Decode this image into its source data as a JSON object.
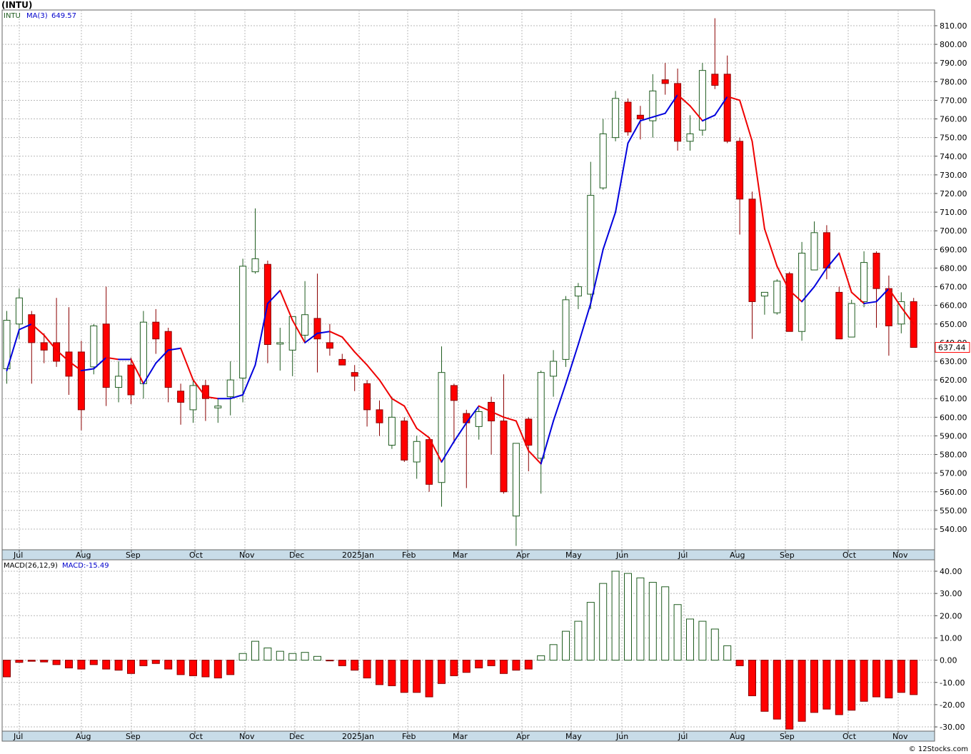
{
  "title": "(INTU)",
  "watermark": "© 12Stocks.com",
  "colors": {
    "up": "#1f5c1f",
    "down": "#ff0000",
    "ma_up": "#0000dd",
    "ma_down": "#ee0000",
    "axis_band": "#c8dce8",
    "grid": "#b8b8b8"
  },
  "price_panel": {
    "symbol": "INTU",
    "ma_label": "MA(3)",
    "ma_value": "649.57",
    "last_price": "637.44",
    "ylim": [
      530,
      815
    ],
    "yticks": [
      "810.00",
      "800.00",
      "790.00",
      "780.00",
      "770.00",
      "760.00",
      "750.00",
      "740.00",
      "730.00",
      "720.00",
      "710.00",
      "700.00",
      "690.00",
      "680.00",
      "670.00",
      "660.00",
      "650.00",
      "640.00",
      "630.00",
      "620.00",
      "610.00",
      "600.00",
      "590.00",
      "580.00",
      "570.00",
      "560.00",
      "550.00",
      "540.00"
    ]
  },
  "macd_panel": {
    "label": "MACD(26,12,9)",
    "value_label": "MACD:-15.49",
    "ylim": [
      -32,
      42
    ],
    "yticks": [
      "40.00",
      "30.00",
      "20.00",
      "10.00",
      "0.00",
      "-10.00",
      "-20.00",
      "-30.00"
    ]
  },
  "month_labels": [
    "Jul",
    "Aug",
    "Sep",
    "Oct",
    "Nov",
    "Dec",
    "2025Jan",
    "Feb",
    "Mar",
    "Apr",
    "May",
    "Jun",
    "Jul",
    "Aug",
    "Sep",
    "Oct",
    "Nov"
  ],
  "chart_data": [
    {
      "type": "candlestick",
      "series": [
        {
          "name": "INTU",
          "values": [
            {
              "o": 626,
              "h": 657,
              "l": 618,
              "c": 652
            },
            {
              "o": 650,
              "h": 669,
              "l": 642,
              "c": 664
            },
            {
              "o": 655,
              "h": 657,
              "l": 618,
              "c": 640
            },
            {
              "o": 640,
              "h": 645,
              "l": 629,
              "c": 636
            },
            {
              "o": 640,
              "h": 664,
              "l": 627,
              "c": 630
            },
            {
              "o": 635,
              "h": 659,
              "l": 612,
              "c": 622
            },
            {
              "o": 635,
              "h": 641,
              "l": 593,
              "c": 604
            },
            {
              "o": 627,
              "h": 650,
              "l": 623,
              "c": 649
            },
            {
              "o": 650,
              "h": 670,
              "l": 606,
              "c": 616
            },
            {
              "o": 616,
              "h": 630,
              "l": 608,
              "c": 622
            },
            {
              "o": 628,
              "h": 632,
              "l": 607,
              "c": 612
            },
            {
              "o": 618,
              "h": 657,
              "l": 610,
              "c": 651
            },
            {
              "o": 651,
              "h": 658,
              "l": 634,
              "c": 642
            },
            {
              "o": 646,
              "h": 648,
              "l": 608,
              "c": 616
            },
            {
              "o": 614,
              "h": 618,
              "l": 596,
              "c": 608
            },
            {
              "o": 604,
              "h": 620,
              "l": 597,
              "c": 617
            },
            {
              "o": 617,
              "h": 620,
              "l": 598,
              "c": 610
            },
            {
              "o": 605,
              "h": 610,
              "l": 597,
              "c": 606
            },
            {
              "o": 611,
              "h": 630,
              "l": 601,
              "c": 620
            },
            {
              "o": 621,
              "h": 685,
              "l": 608,
              "c": 681
            },
            {
              "o": 678,
              "h": 712,
              "l": 677,
              "c": 685
            },
            {
              "o": 682,
              "h": 684,
              "l": 629,
              "c": 639
            },
            {
              "o": 640,
              "h": 648,
              "l": 625,
              "c": 640
            },
            {
              "o": 636,
              "h": 650,
              "l": 622,
              "c": 654
            },
            {
              "o": 644,
              "h": 673,
              "l": 640,
              "c": 655
            },
            {
              "o": 653,
              "h": 677,
              "l": 624,
              "c": 642
            },
            {
              "o": 640,
              "h": 650,
              "l": 633,
              "c": 637
            },
            {
              "o": 631,
              "h": 634,
              "l": 628,
              "c": 628
            },
            {
              "o": 624,
              "h": 628,
              "l": 614,
              "c": 622
            },
            {
              "o": 618,
              "h": 620,
              "l": 595,
              "c": 604
            },
            {
              "o": 604,
              "h": 609,
              "l": 590,
              "c": 597
            },
            {
              "o": 585,
              "h": 611,
              "l": 583,
              "c": 600
            },
            {
              "o": 598,
              "h": 600,
              "l": 576,
              "c": 577
            },
            {
              "o": 576,
              "h": 590,
              "l": 567,
              "c": 587
            },
            {
              "o": 588,
              "h": 589,
              "l": 560,
              "c": 564
            },
            {
              "o": 565,
              "h": 638,
              "l": 552,
              "c": 624
            },
            {
              "o": 617,
              "h": 618,
              "l": 586,
              "c": 609
            },
            {
              "o": 602,
              "h": 604,
              "l": 562,
              "c": 597
            },
            {
              "o": 595,
              "h": 605,
              "l": 588,
              "c": 603
            },
            {
              "o": 608,
              "h": 611,
              "l": 580,
              "c": 598
            },
            {
              "o": 598,
              "h": 623,
              "l": 559,
              "c": 560
            },
            {
              "o": 547,
              "h": 581,
              "l": 531,
              "c": 586
            },
            {
              "o": 599,
              "h": 600,
              "l": 571,
              "c": 585
            },
            {
              "o": 578,
              "h": 625,
              "l": 559,
              "c": 624
            },
            {
              "o": 622,
              "h": 636,
              "l": 611,
              "c": 630
            },
            {
              "o": 631,
              "h": 665,
              "l": 627,
              "c": 663
            },
            {
              "o": 665,
              "h": 672,
              "l": 658,
              "c": 670
            },
            {
              "o": 666,
              "h": 737,
              "l": 658,
              "c": 719
            },
            {
              "o": 723,
              "h": 760,
              "l": 722,
              "c": 752
            },
            {
              "o": 750,
              "h": 775,
              "l": 748,
              "c": 771
            },
            {
              "o": 769,
              "h": 771,
              "l": 751,
              "c": 753
            },
            {
              "o": 762,
              "h": 767,
              "l": 749,
              "c": 760
            },
            {
              "o": 759,
              "h": 784,
              "l": 750,
              "c": 775
            },
            {
              "o": 781,
              "h": 790,
              "l": 773,
              "c": 779
            },
            {
              "o": 779,
              "h": 787,
              "l": 743,
              "c": 748
            },
            {
              "o": 748,
              "h": 762,
              "l": 743,
              "c": 752
            },
            {
              "o": 754,
              "h": 790,
              "l": 751,
              "c": 786
            },
            {
              "o": 784,
              "h": 814,
              "l": 776,
              "c": 778
            },
            {
              "o": 784,
              "h": 794,
              "l": 747,
              "c": 748
            },
            {
              "o": 748,
              "h": 750,
              "l": 698,
              "c": 717
            },
            {
              "o": 717,
              "h": 721,
              "l": 642,
              "c": 662
            },
            {
              "o": 665,
              "h": 667,
              "l": 655,
              "c": 667
            },
            {
              "o": 656,
              "h": 674,
              "l": 655,
              "c": 673
            },
            {
              "o": 677,
              "h": 678,
              "l": 646,
              "c": 646
            },
            {
              "o": 646,
              "h": 694,
              "l": 641,
              "c": 688
            },
            {
              "o": 679,
              "h": 705,
              "l": 682,
              "c": 699
            },
            {
              "o": 699,
              "h": 703,
              "l": 674,
              "c": 680
            },
            {
              "o": 667,
              "h": 670,
              "l": 642,
              "c": 642
            },
            {
              "o": 643,
              "h": 663,
              "l": 643,
              "c": 661
            },
            {
              "o": 662,
              "h": 689,
              "l": 659,
              "c": 683
            },
            {
              "o": 688,
              "h": 689,
              "l": 648,
              "c": 669
            },
            {
              "o": 669,
              "h": 676,
              "l": 633,
              "c": 649
            },
            {
              "o": 650,
              "h": 667,
              "l": 645,
              "c": 662
            },
            {
              "o": 662,
              "h": 664,
              "l": 638,
              "c": 637.44
            }
          ]
        },
        {
          "name": "MA(3)",
          "values": [
            625,
            647,
            650,
            644,
            636,
            630,
            625,
            626,
            632,
            631,
            631,
            618,
            629,
            636,
            637,
            620,
            611,
            610,
            610,
            612,
            628,
            661,
            668,
            652,
            640,
            645,
            646,
            643,
            635,
            628,
            620,
            610,
            606,
            594,
            589,
            576,
            587,
            597,
            606,
            603,
            600,
            598,
            582,
            575,
            598,
            618,
            639,
            661,
            690,
            710,
            747,
            759,
            761,
            763,
            773,
            767,
            759,
            762,
            772,
            770,
            748,
            701,
            681,
            668,
            662,
            670,
            680,
            688,
            667,
            661,
            662,
            669,
            659,
            650
          ]
        }
      ],
      "ylim": [
        530,
        815
      ]
    },
    {
      "type": "bar",
      "series": [
        {
          "name": "MACD(26,12,9)",
          "values": [
            -7.5,
            -1,
            -0.5,
            -0.8,
            -2,
            -3.5,
            -4,
            -2,
            -4,
            -4.5,
            -6,
            -2.5,
            -1.5,
            -4,
            -6.5,
            -7,
            -7.5,
            -8,
            -6.5,
            3,
            8.5,
            5.5,
            4,
            3,
            3.5,
            1.7,
            -0.3,
            -2.5,
            -4.5,
            -8,
            -11,
            -11.5,
            -14.5,
            -14.5,
            -16.5,
            -10.5,
            -7,
            -5.5,
            -3.5,
            -2.5,
            -6,
            -4.5,
            -4,
            2,
            7,
            13,
            17.5,
            26,
            34.5,
            40,
            39,
            37,
            35,
            33,
            25,
            18.5,
            17.5,
            14,
            6.5,
            -2.5,
            -16,
            -23,
            -26.5,
            -31,
            -27.5,
            -23.5,
            -22,
            -24.5,
            -22.5,
            -18.5,
            -16.5,
            -17,
            -14.5,
            -15.49
          ]
        }
      ],
      "ylim": [
        -32,
        42
      ]
    }
  ]
}
